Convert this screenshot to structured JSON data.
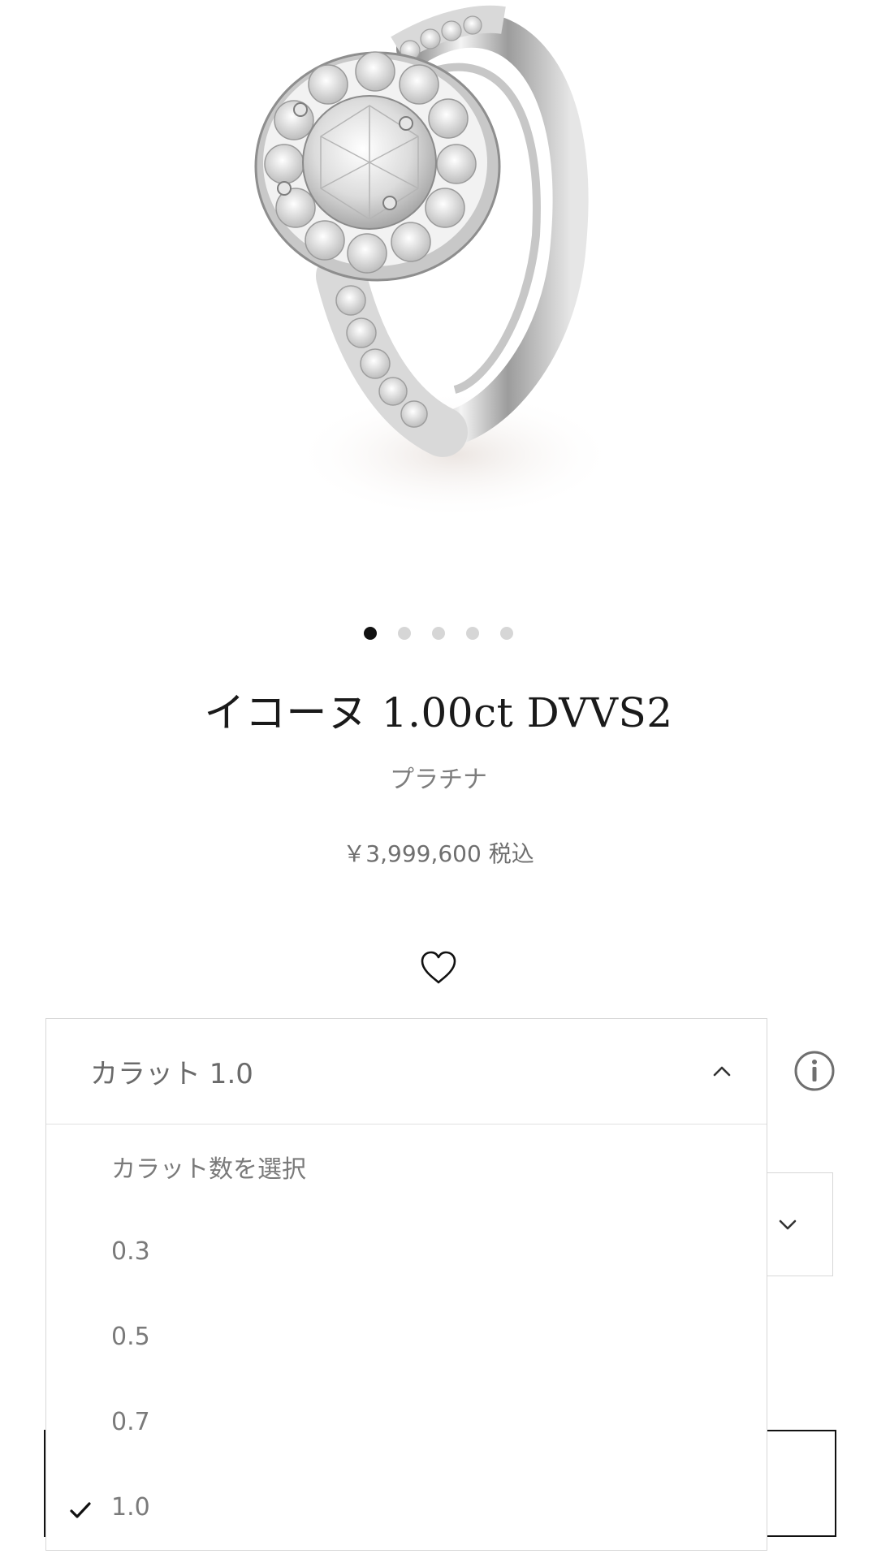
{
  "product": {
    "title": "イコーヌ 1.00ct DVVS2",
    "material": "プラチナ",
    "price": "￥3,999,600 税込",
    "image_alt": "ring-image"
  },
  "carousel": {
    "total": 5,
    "active_index": 0
  },
  "carat_dropdown": {
    "selected_label": "カラット 1.0",
    "placeholder": "カラット数を選択",
    "options": [
      "0.3",
      "0.5",
      "0.7",
      "1.0"
    ],
    "selected_value": "1.0",
    "expanded": true
  },
  "icons": {
    "wishlist": "heart-icon",
    "info": "info-icon",
    "dropdown_toggle": "chevron-up-icon",
    "secondary_select": "chevron-down-icon",
    "selected_marker": "check-icon"
  }
}
